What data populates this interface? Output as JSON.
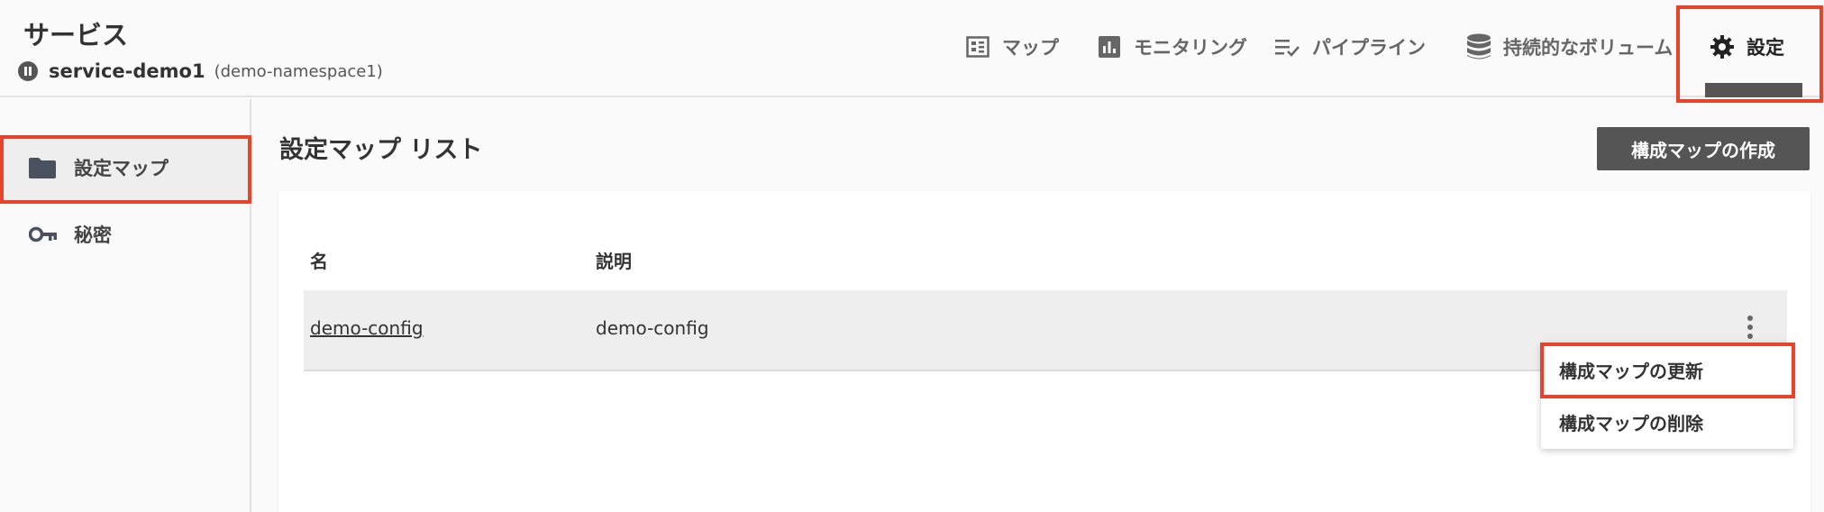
{
  "header": {
    "title": "サービス",
    "service_name": "service-demo1",
    "namespace": "(demo-namespace1)",
    "service_icon": "service-icon"
  },
  "tabs": [
    {
      "label": "マップ",
      "icon": "map-grid-icon"
    },
    {
      "label": "モニタリング",
      "icon": "bar-chart-icon"
    },
    {
      "label": "パイプライン",
      "icon": "list-check-icon"
    },
    {
      "label": "持続的なボリューム",
      "icon": "database-icon"
    },
    {
      "label": "設定",
      "icon": "gear-icon",
      "active": true
    }
  ],
  "sidebar": {
    "items": [
      {
        "label": "設定マップ",
        "icon": "folder-icon",
        "selected": true
      },
      {
        "label": "秘密",
        "icon": "key-icon"
      }
    ]
  },
  "main": {
    "title": "設定マップ リスト",
    "create_button": "構成マップの作成",
    "table": {
      "columns": [
        "名",
        "説明"
      ],
      "rows": [
        {
          "name": "demo-config",
          "description": "demo-config"
        }
      ]
    }
  },
  "context_menu": {
    "items": [
      "構成マップの更新",
      "構成マップの削除"
    ]
  },
  "colors": {
    "highlight": "#e8442c",
    "button": "#555555",
    "row_bg": "#eeeeee"
  }
}
